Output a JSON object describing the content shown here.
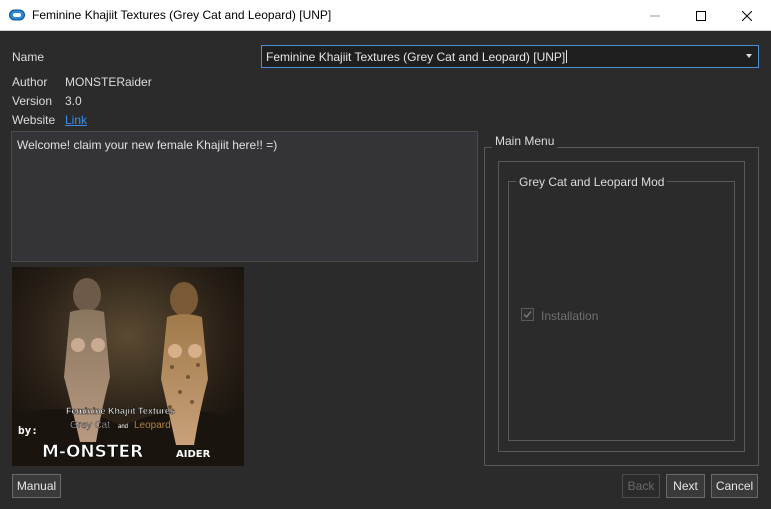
{
  "window": {
    "title": "Feminine Khajiit Textures (Grey Cat and Leopard) [UNP]",
    "icon": "app-logo-icon"
  },
  "fields": {
    "name_label": "Name",
    "name_value": "Feminine Khajiit Textures (Grey Cat and Leopard) [UNP]",
    "author_label": "Author",
    "author_value": "MONSTERaider",
    "version_label": "Version",
    "version_value": "3.0",
    "website_label": "Website",
    "website_link": "Link"
  },
  "description": "Welcome! claim your new female Khajiit here!! =)",
  "preview": {
    "title": "Feminine Khajiit Textures",
    "subtitle_a": "Grey Cat",
    "subtitle_and": "and",
    "subtitle_b": "Leopard",
    "by": "by:",
    "brand": "M-ONSTER",
    "brand_suffix": "AIDER"
  },
  "main_menu": {
    "label": "Main Menu",
    "group_label": "Grey Cat and Leopard Mod",
    "option_label": "Installation",
    "option_checked": true,
    "option_disabled": true
  },
  "buttons": {
    "manual": "Manual",
    "back": "Back",
    "next": "Next",
    "cancel": "Cancel"
  },
  "colors": {
    "background": "#2b2b2b",
    "accent": "#4a90d9",
    "link": "#3d8ee6"
  }
}
